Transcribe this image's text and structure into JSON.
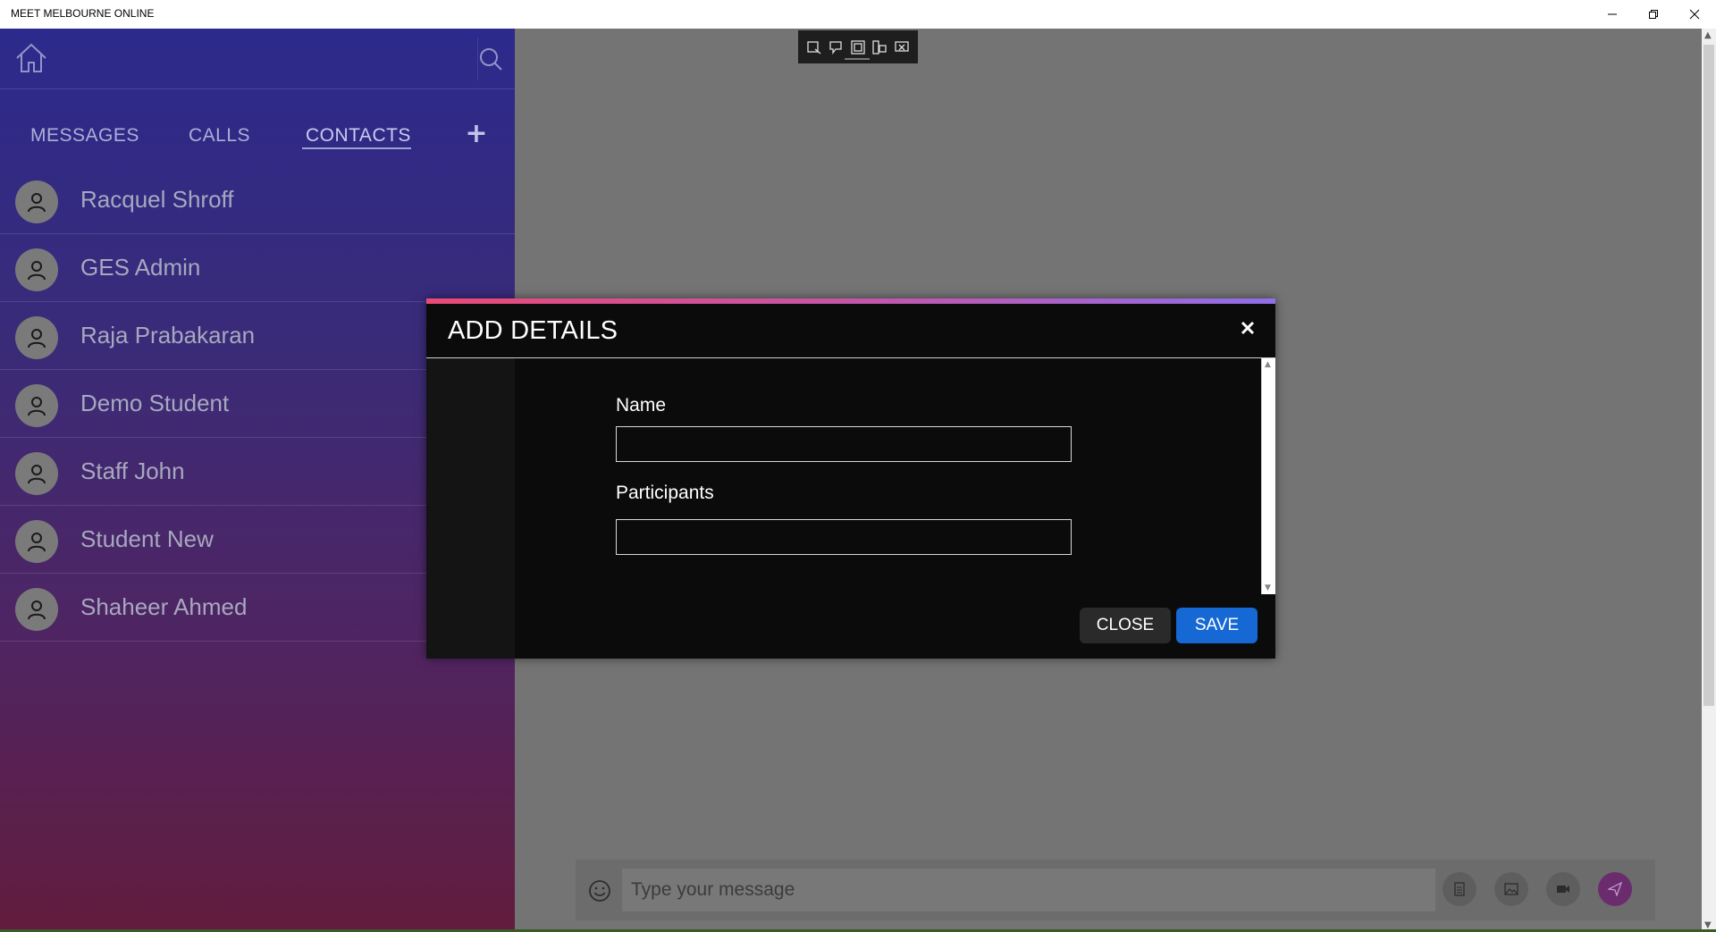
{
  "window": {
    "title": "MEET MELBOURNE ONLINE"
  },
  "sidebar": {
    "tabs": [
      {
        "label": "MESSAGES",
        "active": false
      },
      {
        "label": "CALLS",
        "active": false
      },
      {
        "label": "CONTACTS",
        "active": true
      }
    ],
    "add_icon": "+",
    "contacts": [
      {
        "name": "Racquel Shroff"
      },
      {
        "name": "GES Admin"
      },
      {
        "name": "Raja Prabakaran"
      },
      {
        "name": "Demo Student"
      },
      {
        "name": "Staff John"
      },
      {
        "name": "Student New"
      },
      {
        "name": "Shaheer Ahmed"
      }
    ]
  },
  "composer": {
    "placeholder": "Type your message"
  },
  "modal": {
    "title": "ADD DETAILS",
    "fields": {
      "name_label": "Name",
      "name_value": "",
      "participants_label": "Participants",
      "participants_value": ""
    },
    "close_label": "CLOSE",
    "save_label": "SAVE"
  },
  "colors": {
    "sidebar_top": "#2c2a8c",
    "sidebar_bottom": "#621c3d",
    "save_button": "#1668d4",
    "modal_accent_start": "#e84a78",
    "modal_accent_end": "#8f6ee8"
  }
}
